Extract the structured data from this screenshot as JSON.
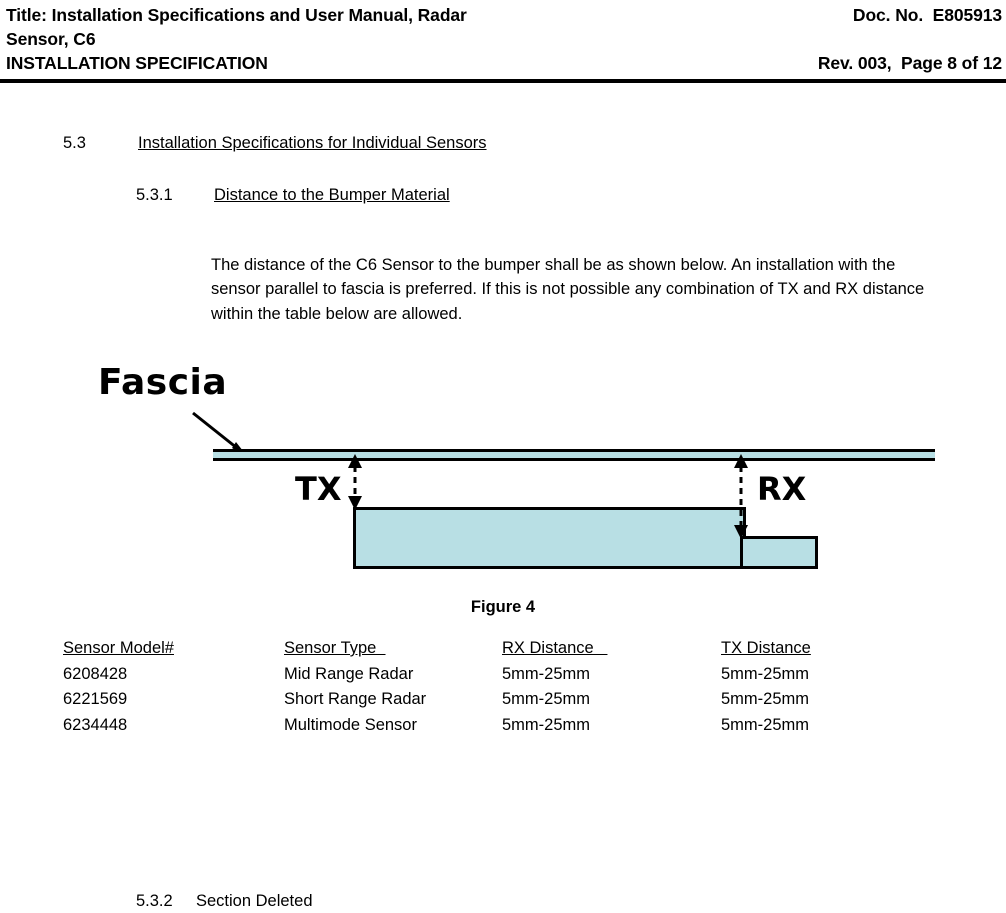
{
  "header": {
    "left_line_1": "Title: Installation Specifications and User Manual, Radar",
    "left_line_2": "Sensor, C6",
    "left_line_3": "INSTALLATION SPECIFICATION",
    "right_line_1": "Doc. No.  E805913",
    "right_line_2": "",
    "right_line_3": "Rev. 003,  Page 8 of 12"
  },
  "sections": {
    "s53": {
      "number": "5.3",
      "title": "Installation Specifications for Individual Sensors"
    },
    "s531": {
      "number": "5.3.1",
      "title": "Distance to the Bumper Material"
    },
    "s532": {
      "number": "5.3.2",
      "title": "Section Deleted"
    }
  },
  "body": {
    "paragraph": "The distance of the C6 Sensor to the bumper shall be as shown below. An installation with the sensor parallel to fascia is preferred. If this is not possible any combination of TX and RX distance within the table below are allowed."
  },
  "figure": {
    "caption": "Figure 4",
    "fascia_label": "Fascia",
    "tx_label": "TX",
    "rx_label": "RX",
    "fill_color": "#b8dfe4",
    "line_color": "#000000"
  },
  "table": {
    "headers": [
      "Sensor Model#",
      "Sensor Type  ",
      "RX Distance   ",
      "TX Distance"
    ],
    "rows": [
      [
        "6208428",
        "Mid Range Radar",
        "5mm-25mm",
        "5mm-25mm"
      ],
      [
        "6221569",
        "Short Range Radar",
        "5mm-25mm",
        "5mm-25mm"
      ],
      [
        "6234448",
        "Multimode Sensor",
        "5mm-25mm",
        "5mm-25mm"
      ]
    ]
  }
}
